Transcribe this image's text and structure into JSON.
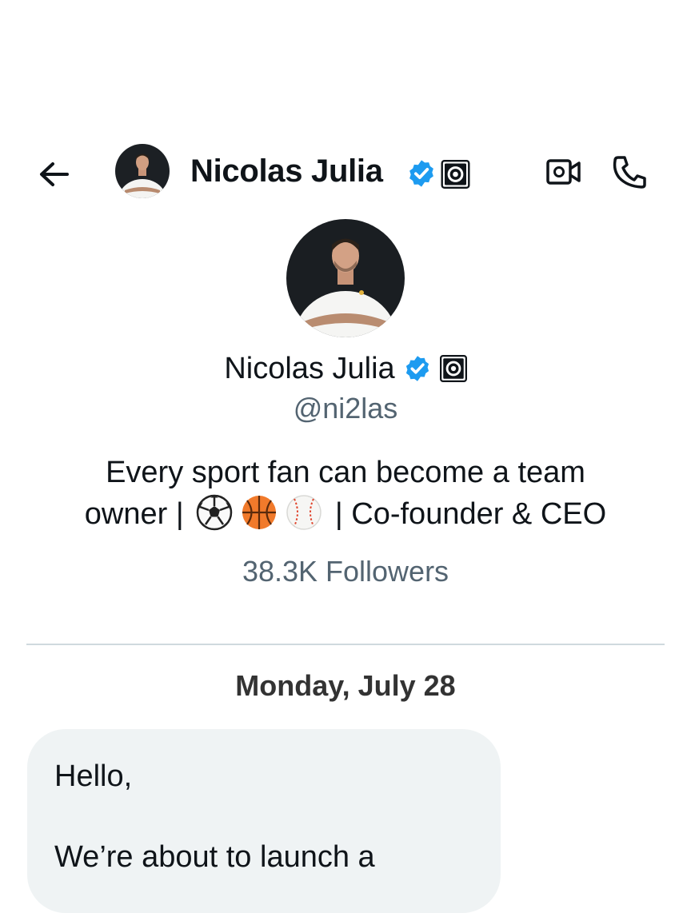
{
  "header": {
    "back_icon": "arrow-left-icon",
    "name": "Nicolas Julia",
    "verified_icon": "verified-badge-icon",
    "affiliation_icon": "affiliation-badge-icon",
    "video_icon": "video-call-icon",
    "call_icon": "phone-call-icon"
  },
  "profile": {
    "name": "Nicolas Julia",
    "handle": "@ni2las",
    "bio_line1": "Every sport fan can become a team",
    "bio_line2_start": "owner | ",
    "bio_emojis": [
      "soccer-ball-icon",
      "basketball-icon",
      "baseball-icon"
    ],
    "bio_line2_end": " | Co-founder & CEO",
    "followers": "38.3K Followers"
  },
  "conversation": {
    "date": "Monday, July 28",
    "message_line1": "Hello,",
    "message_line2": "We’re about to launch a"
  },
  "colors": {
    "verified_blue": "#1d9bf0",
    "secondary_text": "#536471",
    "bubble_bg": "#eff3f4",
    "divider": "#cfd9de"
  }
}
